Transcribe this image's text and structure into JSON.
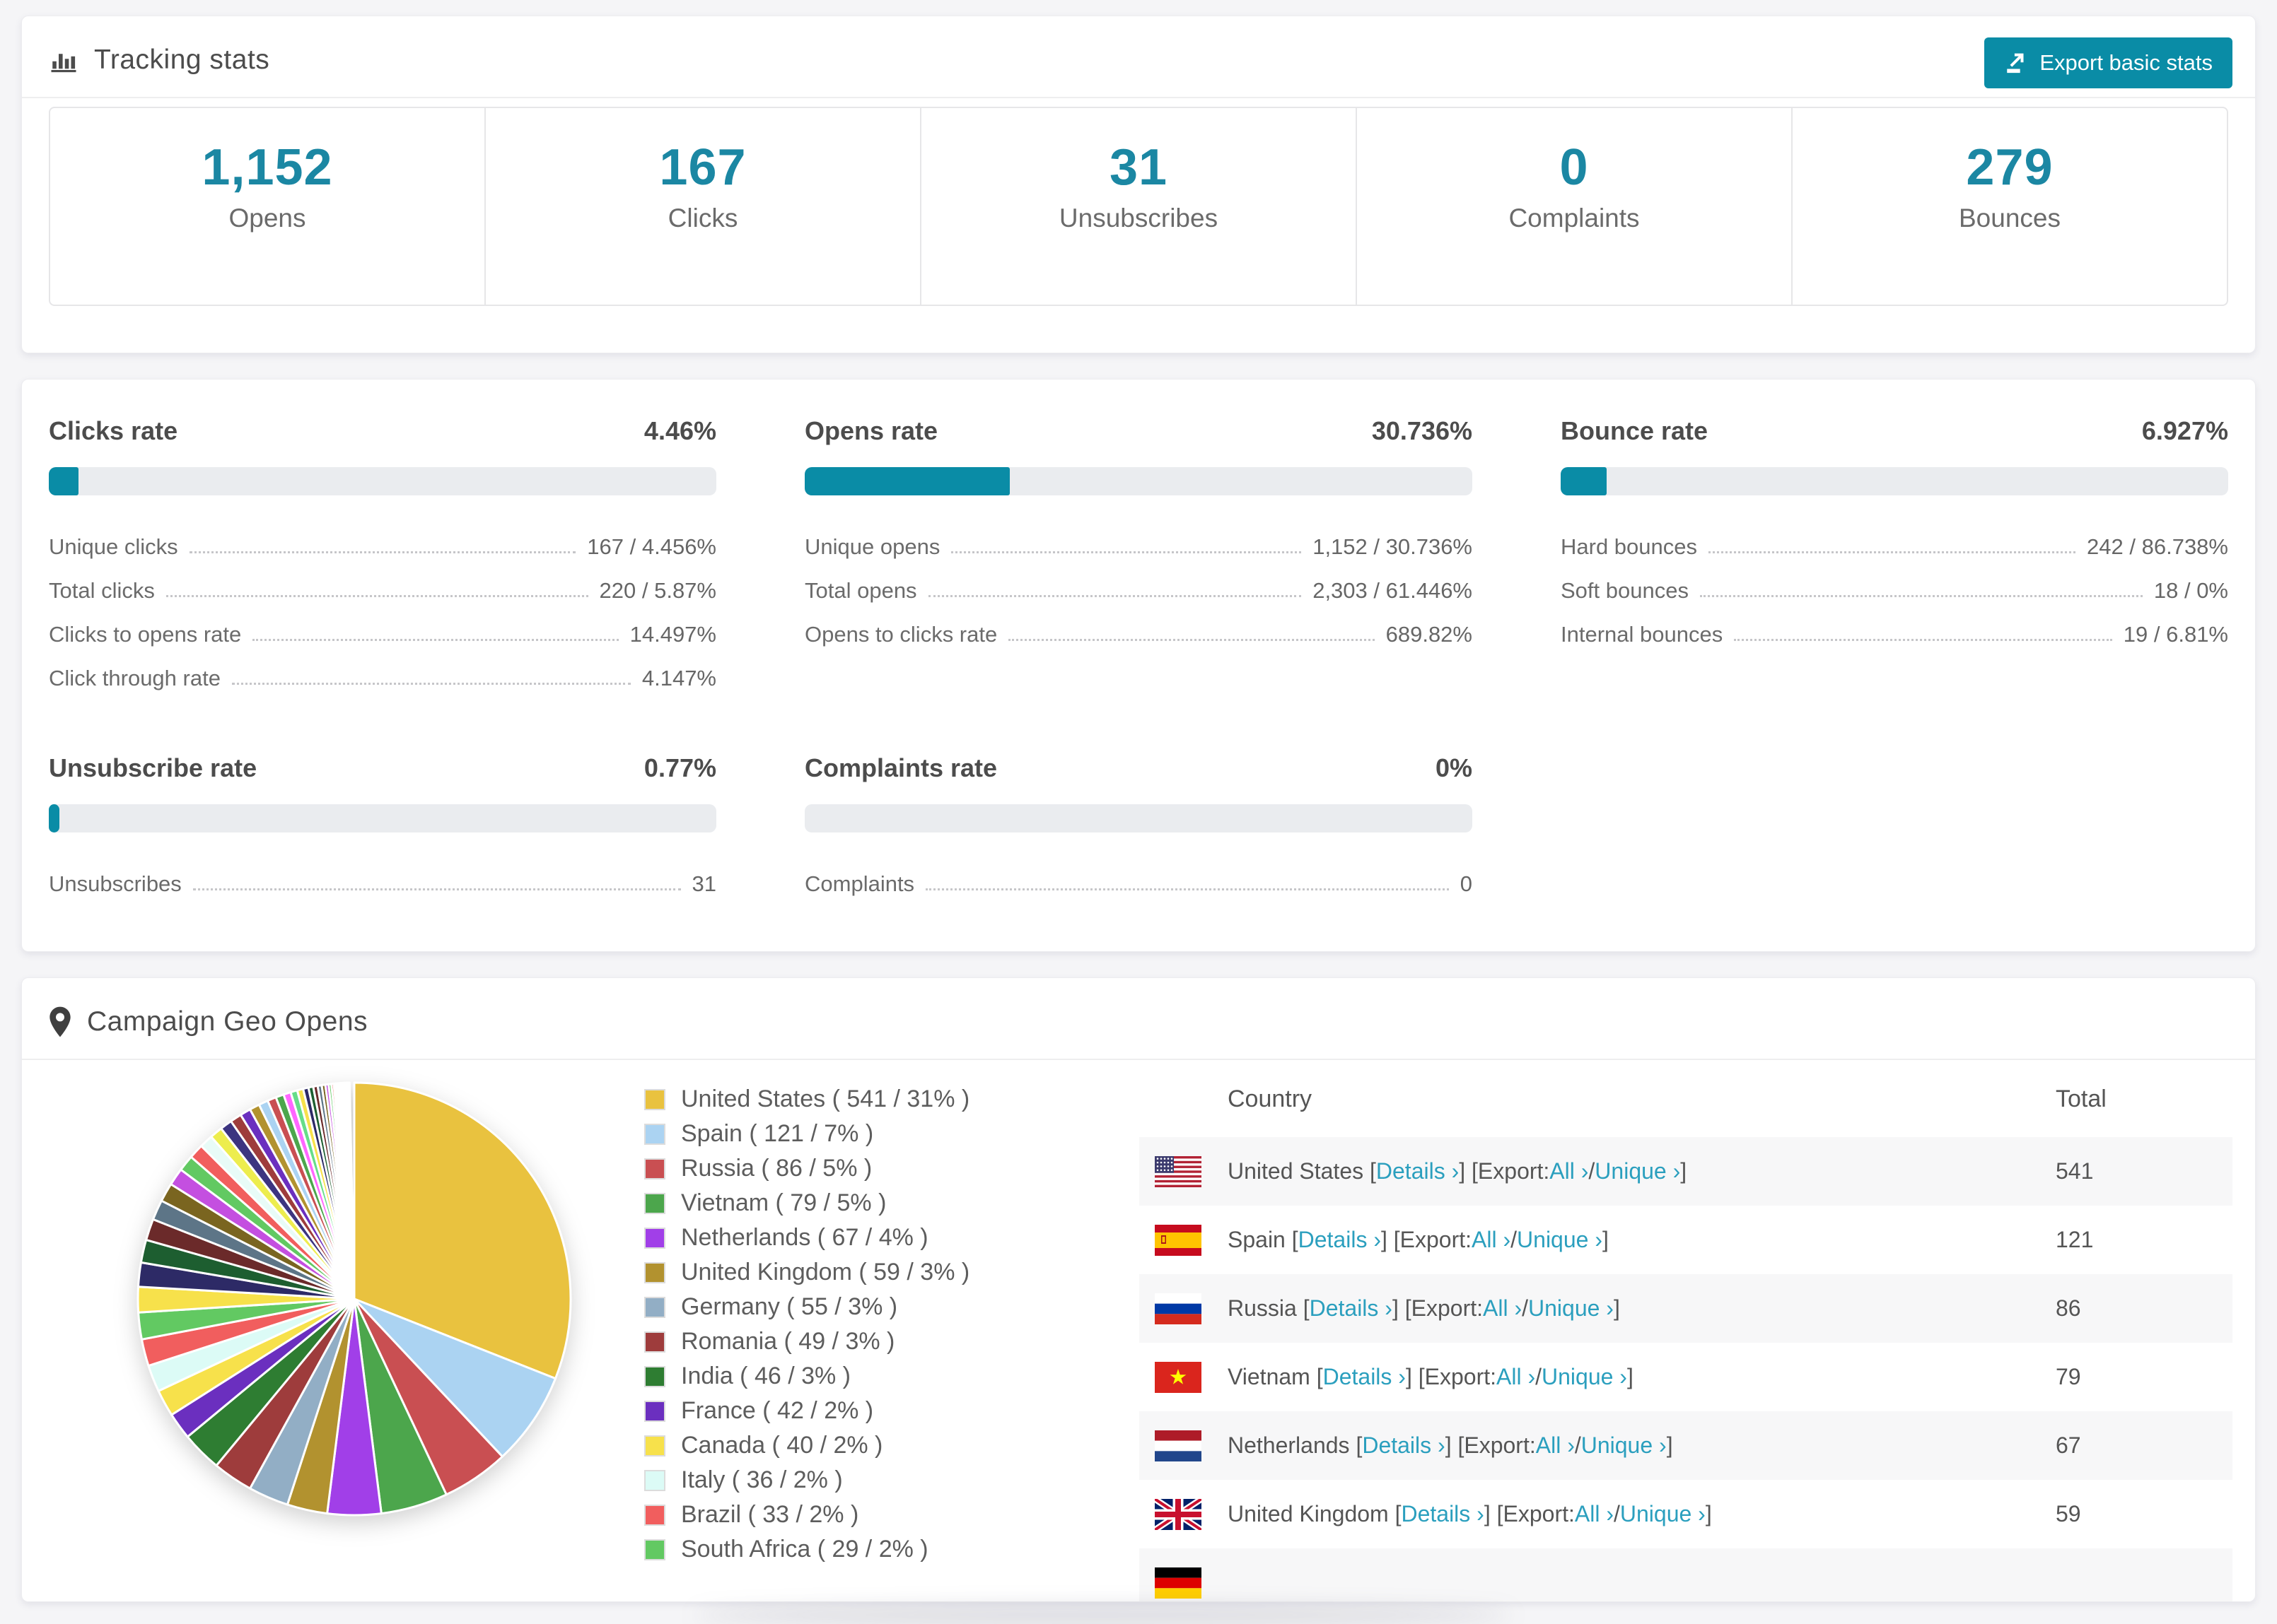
{
  "tracking": {
    "title": "Tracking stats",
    "export_button": "Export basic stats",
    "accent_color": "#0a8ca6",
    "number_color": "#1b87a3"
  },
  "summary": [
    {
      "value": "1,152",
      "label": "Opens"
    },
    {
      "value": "167",
      "label": "Clicks"
    },
    {
      "value": "31",
      "label": "Unsubscribes"
    },
    {
      "value": "0",
      "label": "Complaints"
    },
    {
      "value": "279",
      "label": "Bounces"
    }
  ],
  "rates": [
    {
      "title": "Clicks rate",
      "percent": "4.46%",
      "bar": 4.46,
      "rows": [
        {
          "label": "Unique clicks",
          "value": "167 / 4.456%"
        },
        {
          "label": "Total clicks",
          "value": "220 / 5.87%"
        },
        {
          "label": "Clicks to opens rate",
          "value": "14.497%"
        },
        {
          "label": "Click through rate",
          "value": "4.147%"
        }
      ]
    },
    {
      "title": "Opens rate",
      "percent": "30.736%",
      "bar": 30.736,
      "rows": [
        {
          "label": "Unique opens",
          "value": "1,152 / 30.736%"
        },
        {
          "label": "Total opens",
          "value": "2,303 / 61.446%"
        },
        {
          "label": "Opens to clicks rate",
          "value": "689.82%"
        }
      ]
    },
    {
      "title": "Bounce rate",
      "percent": "6.927%",
      "bar": 6.927,
      "rows": [
        {
          "label": "Hard bounces",
          "value": "242 / 86.738%"
        },
        {
          "label": "Soft bounces",
          "value": "18 / 0%"
        },
        {
          "label": "Internal bounces",
          "value": "19 / 6.81%"
        }
      ]
    },
    {
      "title": "Unsubscribe rate",
      "percent": "0.77%",
      "bar": 0.77,
      "rows": [
        {
          "label": "Unsubscribes",
          "value": "31"
        }
      ]
    },
    {
      "title": "Complaints rate",
      "percent": "0%",
      "bar": 0,
      "rows": [
        {
          "label": "Complaints",
          "value": "0"
        }
      ]
    }
  ],
  "geo": {
    "title": "Campaign Geo Opens",
    "table": {
      "columns": [
        "Country",
        "Total"
      ],
      "links": {
        "details": "Details",
        "export": "Export:",
        "all": "All",
        "unique": "Unique",
        "arrow": "›"
      },
      "rows": [
        {
          "country": "United States",
          "flag": "us",
          "total": "541"
        },
        {
          "country": "Spain",
          "flag": "es",
          "total": "121"
        },
        {
          "country": "Russia",
          "flag": "ru",
          "total": "86"
        },
        {
          "country": "Vietnam",
          "flag": "vn",
          "total": "79"
        },
        {
          "country": "Netherlands",
          "flag": "nl",
          "total": "67"
        },
        {
          "country": "United Kingdom",
          "flag": "gb",
          "total": "59"
        },
        {
          "country": "",
          "flag": "de",
          "total": "",
          "partial": true
        }
      ]
    }
  },
  "chart_data": {
    "type": "pie",
    "title": "Campaign Geo Opens",
    "legend_position": "right",
    "slices": [
      {
        "label": "United States",
        "value": 541,
        "percent": 31,
        "color": "#e9c23f"
      },
      {
        "label": "Spain",
        "value": 121,
        "percent": 7,
        "color": "#abd3f2"
      },
      {
        "label": "Russia",
        "value": 86,
        "percent": 5,
        "color": "#c94f52"
      },
      {
        "label": "Vietnam",
        "value": 79,
        "percent": 5,
        "color": "#4ca64c"
      },
      {
        "label": "Netherlands",
        "value": 67,
        "percent": 4,
        "color": "#a13fe8"
      },
      {
        "label": "United Kingdom",
        "value": 59,
        "percent": 3,
        "color": "#b2922f"
      },
      {
        "label": "Germany",
        "value": 55,
        "percent": 3,
        "color": "#92aec5"
      },
      {
        "label": "Romania",
        "value": 49,
        "percent": 3,
        "color": "#9e3c3c"
      },
      {
        "label": "India",
        "value": 46,
        "percent": 3,
        "color": "#2e7d32"
      },
      {
        "label": "France",
        "value": 42,
        "percent": 2,
        "color": "#6b2fbf"
      },
      {
        "label": "Canada",
        "value": 40,
        "percent": 2,
        "color": "#f7e14b"
      },
      {
        "label": "Italy",
        "value": 36,
        "percent": 2,
        "color": "#dcfbf6"
      },
      {
        "label": "Brazil",
        "value": 33,
        "percent": 2,
        "color": "#f15e5e"
      },
      {
        "label": "South Africa",
        "value": 29,
        "percent": 2,
        "color": "#62c962"
      }
    ],
    "legend_format": "{label} ( {value} / {percent}% )",
    "others_percents": [
      1.9,
      1.8,
      1.7,
      1.6,
      1.5,
      1.4,
      1.3,
      1.2,
      1.1,
      1.0,
      0.95,
      0.9,
      0.85,
      0.8,
      0.75,
      0.7,
      0.65,
      0.6,
      0.55,
      0.5,
      0.45,
      0.4,
      0.36,
      0.33,
      0.3,
      0.27,
      0.24,
      0.21,
      0.18,
      0.16,
      0.14,
      0.12,
      0.1,
      0.09,
      0.08,
      0.07,
      0.06,
      0.05,
      0.05,
      0.04,
      0.04,
      0.03,
      0.03,
      0.02,
      0.02,
      0.02,
      0.01,
      0.01,
      0.01,
      0.01
    ],
    "others_palette": [
      "#f7e14b",
      "#2d2a66",
      "#1d5e30",
      "#6b2a2a",
      "#5d7587",
      "#7a6520",
      "#c44fe0",
      "#62c962",
      "#f15e5e",
      "#e8fbf7",
      "#eded4e",
      "#3c3480",
      "#9e3c3c",
      "#6b2fbf",
      "#b2922f",
      "#abd3f2",
      "#c94f52",
      "#4ca64c",
      "#ff66ff",
      "#66dd88"
    ]
  }
}
